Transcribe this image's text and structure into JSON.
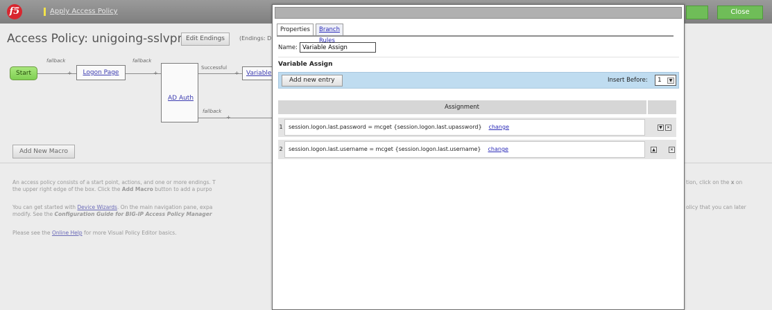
{
  "topbar": {
    "apply_label": "Apply Access Policy",
    "close_label": "Close",
    "logo_text": "f5"
  },
  "title": {
    "text": "Access Policy: unigoing-sslvpn",
    "edit_endings_label": "Edit Endings",
    "endings_text": "(Endings: D"
  },
  "flow": {
    "start_label": "Start",
    "fallback_label": "fallback",
    "successful_label": "Successful",
    "plus": "+",
    "logon_label": "Logon Page",
    "adauth_label": "AD Auth",
    "variable_label": "Variable"
  },
  "add_macro_label": "Add New Macro",
  "help": {
    "p1_line1_a": "An access policy consists of a start point, actions, and one or more endings. T",
    "p1_line1_b": "tion, click on the ",
    "p1_line1_x": "x",
    "p1_line1_c": " on",
    "p1_line2_a": "the upper right edge of the box. Click the ",
    "p1_line2_bold": "Add Macro",
    "p1_line2_b": " button to add a purpo",
    "p2_line1_a": "You can get started with ",
    "p2_line1_link": "Device Wizards",
    "p2_line1_b": ". On the main navigation pane, expa",
    "p2_line1_c": "olicy that you can later",
    "p2_line2_a": "modify. See the ",
    "p2_line2_bold": "Configuration Guide for BIG-IP Access Policy Manager",
    "p3_a": "Please see the ",
    "p3_link": "Online Help",
    "p3_b": " for more Visual Policy Editor basics."
  },
  "dialog": {
    "tabs": [
      {
        "label": "Properties",
        "active": true
      },
      {
        "label": "Branch Rules",
        "active": false
      }
    ],
    "name_label": "Name:",
    "name_value": "Variable Assign",
    "section_heading": "Variable Assign",
    "add_entry_label": "Add new entry",
    "insert_before_label": "Insert Before:",
    "insert_before_value": "1",
    "assignment_header": "Assignment",
    "rows": [
      {
        "num": "1",
        "expr": "session.logon.last.password = mcget {session.logon.last.upassword}",
        "change": "change"
      },
      {
        "num": "2",
        "expr": "session.logon.last.username = mcget {session.logon.last.username}",
        "change": "change"
      }
    ]
  },
  "colors": {
    "topbar": "#8c8c8c",
    "accent_green": "#6fbd58",
    "entry_bar": "#bfdcf0",
    "link": "#2a2ab8"
  },
  "icons": {
    "logo": "f5-logo-icon",
    "select_arrow": "chevron-down-icon",
    "row_down": "move-down-icon",
    "row_delete": "delete-icon"
  }
}
